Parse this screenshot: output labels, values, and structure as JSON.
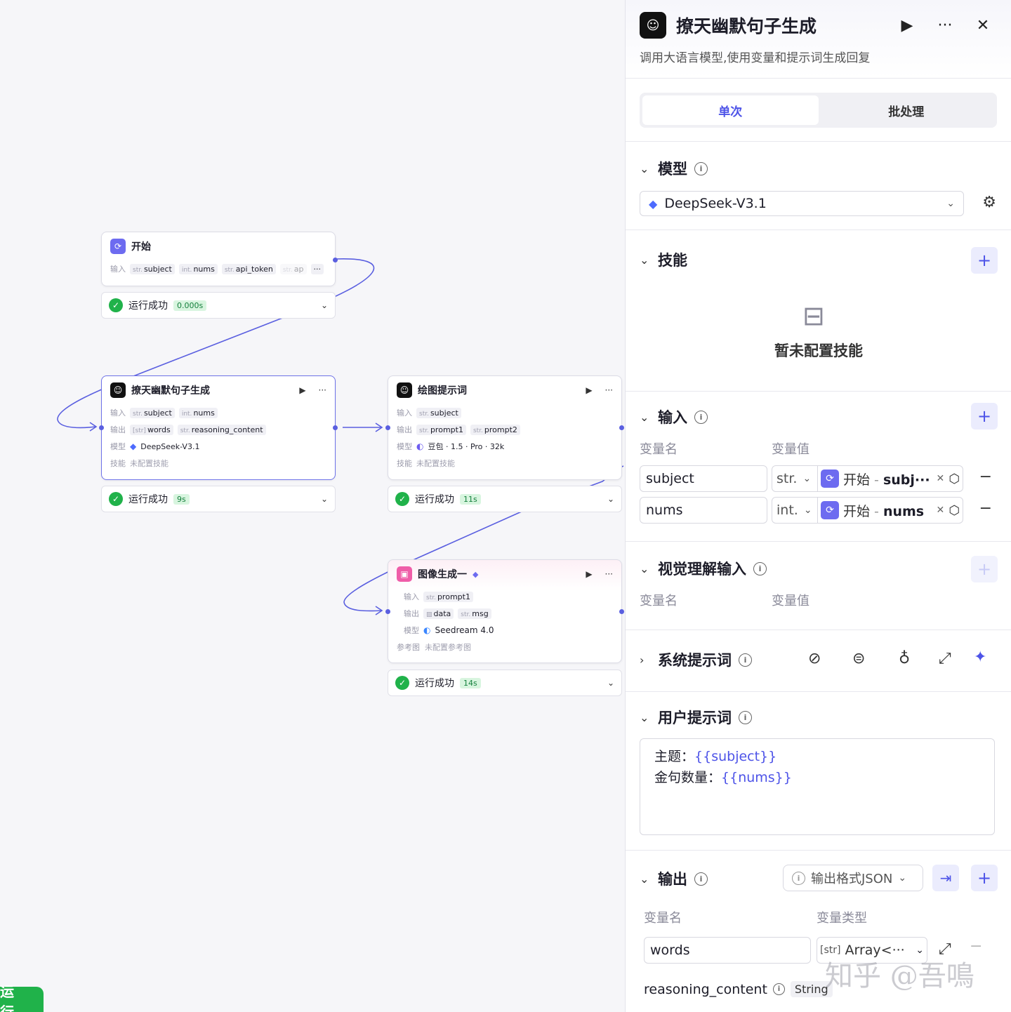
{
  "canvas": {
    "run_button": "运行",
    "nodes": {
      "start": {
        "title": "开始",
        "input_label": "输入",
        "inputs": [
          {
            "type": "str.",
            "name": "subject"
          },
          {
            "type": "int.",
            "name": "nums"
          },
          {
            "type": "str.",
            "name": "api_token"
          },
          {
            "type": "str.",
            "name": "ap"
          }
        ],
        "more": "···",
        "status": "运行成功",
        "duration": "0.000s"
      },
      "llm1": {
        "title": "撩天幽默句子生成",
        "input_label": "输入",
        "inputs": [
          {
            "type": "str.",
            "name": "subject"
          },
          {
            "type": "int.",
            "name": "nums"
          }
        ],
        "output_label": "输出",
        "outputs": [
          {
            "type": "[str]",
            "name": "words"
          },
          {
            "type": "str.",
            "name": "reasoning_content"
          }
        ],
        "model_label": "模型",
        "model": "DeepSeek-V3.1",
        "skill_label": "技能",
        "skill": "未配置技能",
        "status": "运行成功",
        "duration": "9s"
      },
      "llm2": {
        "title": "绘图提示词",
        "input_label": "输入",
        "inputs": [
          {
            "type": "str.",
            "name": "subject"
          }
        ],
        "output_label": "输出",
        "outputs": [
          {
            "type": "str.",
            "name": "prompt1"
          },
          {
            "type": "str.",
            "name": "prompt2"
          }
        ],
        "model_label": "模型",
        "model": "豆包 · 1.5 · Pro · 32k",
        "skill_label": "技能",
        "skill": "未配置技能",
        "status": "运行成功",
        "duration": "11s"
      },
      "img": {
        "title": "图像生成一",
        "input_label": "输入",
        "inputs": [
          {
            "type": "str.",
            "name": "prompt1"
          }
        ],
        "output_label": "输出",
        "outputs": [
          {
            "type": "img",
            "name": "data"
          },
          {
            "type": "str.",
            "name": "msg"
          }
        ],
        "model_label": "模型",
        "model": "Seedream 4.0",
        "ref_label": "参考图",
        "ref": "未配置参考图",
        "status": "运行成功",
        "duration": "14s"
      }
    }
  },
  "panel": {
    "title": "撩天幽默句子生成",
    "description": "调用大语言模型,使用变量和提示词生成回复",
    "tabs": [
      "单次",
      "批处理"
    ],
    "model": {
      "title": "模型",
      "selected": "DeepSeek-V3.1"
    },
    "skills": {
      "title": "技能",
      "empty": "暂未配置技能"
    },
    "inputs": {
      "title": "输入",
      "col_name": "变量名",
      "col_value": "变量值",
      "rows": [
        {
          "name": "subject",
          "type": "str.",
          "ref_node": "开始",
          "ref_sep": " - ",
          "ref_var": "subj···"
        },
        {
          "name": "nums",
          "type": "int.",
          "ref_node": "开始",
          "ref_sep": " - ",
          "ref_var": "nums"
        }
      ]
    },
    "vision": {
      "title": "视觉理解输入",
      "col_name": "变量名",
      "col_value": "变量值"
    },
    "system_prompt": {
      "title": "系统提示词"
    },
    "user_prompt": {
      "title": "用户提示词",
      "line1_label": "主题：",
      "line1_var": "{{subject}}",
      "line2_label": "金句数量：",
      "line2_var": "{{nums}}"
    },
    "output": {
      "title": "输出",
      "format": "输出格式JSON",
      "col_name": "变量名",
      "col_type": "变量类型",
      "rows": [
        {
          "name": "words",
          "type_icon": "[str]",
          "type": "Array<···"
        }
      ],
      "extra_name": "reasoning_content",
      "extra_type": "String"
    }
  },
  "watermark": "知乎 @吾鳴"
}
